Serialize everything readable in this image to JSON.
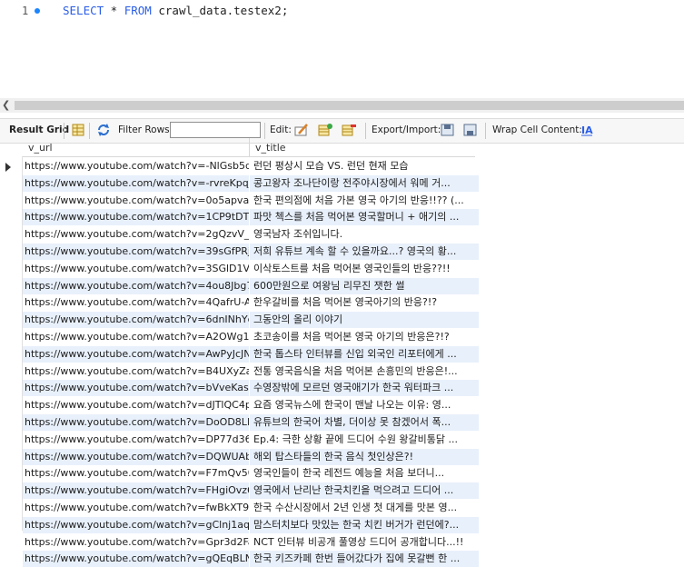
{
  "editor": {
    "line_number": "1",
    "keyword_select": "SELECT",
    "star": " * ",
    "keyword_from": "FROM",
    "table": " crawl_data.testex2;"
  },
  "toolbar": {
    "result_grid": "Result Grid",
    "filter_rows": "Filter Rows:",
    "filter_value": "",
    "edit": "Edit:",
    "export_import": "Export/Import:",
    "wrap_cell": "Wrap Cell Content:"
  },
  "grid": {
    "columns": [
      "v_url",
      "v_title"
    ],
    "rows": [
      {
        "url": "https://www.youtube.com/watch?v=-NlGsb5dmPI",
        "title": "런던 평상시 모습 VS. 런던 현재 모습"
      },
      {
        "url": "https://www.youtube.com/watch?v=-rvreKpqjeY",
        "title": "콩고왕자 조나단이랑 전주야시장에서 워메 거..."
      },
      {
        "url": "https://www.youtube.com/watch?v=0o5apvaD...",
        "title": "한국 편의점에 처음 가본 영국 아기의 반응!!?? (..."
      },
      {
        "url": "https://www.youtube.com/watch?v=1CP9tDTE...",
        "title": "파맛 첵스를 처음 먹어본 영국할머니 + 애기의 ..."
      },
      {
        "url": "https://www.youtube.com/watch?v=2gQzvV_y...",
        "title": "영국남자 조쉬입니다."
      },
      {
        "url": "https://www.youtube.com/watch?v=39sGfPRjb...",
        "title": "저희 유튜브 계속 할 수 있을까요...? 영국의 황..."
      },
      {
        "url": "https://www.youtube.com/watch?v=3SGlD1VZ...",
        "title": "이삭토스트를 처음 먹어본 영국인들의 반응??!!"
      },
      {
        "url": "https://www.youtube.com/watch?v=4ou8Jbg7...",
        "title": "600만원으로 여왕님 리무진 잿한 썰"
      },
      {
        "url": "https://www.youtube.com/watch?v=4QafrU-AX9I",
        "title": "한우갈비를 처음 먹어본 영국아기의 반응?!?"
      },
      {
        "url": "https://www.youtube.com/watch?v=6dnINhYg...",
        "title": "그동안의 올리 이야기"
      },
      {
        "url": "https://www.youtube.com/watch?v=A2OWg1h...",
        "title": "초코송이를 처음 먹어본 영국 아기의 반응은?!?"
      },
      {
        "url": "https://www.youtube.com/watch?v=AwPyJcJN...",
        "title": "한국 톱스타 인터뷰를 신입 외국인 리포터에게 ..."
      },
      {
        "url": "https://www.youtube.com/watch?v=B4UXyZaE...",
        "title": "전통 영국음식을 처음 먹어본 손흥민의 반응은!..."
      },
      {
        "url": "https://www.youtube.com/watch?v=bVveKasF...",
        "title": "수영장밖에 모르던 영국애기가 한국 워터파크 ..."
      },
      {
        "url": "https://www.youtube.com/watch?v=dJTlQC4p...",
        "title": "요즘 영국뉴스에 한국이 맨날 나오는 이유: 영..."
      },
      {
        "url": "https://www.youtube.com/watch?v=DoOD8LB...",
        "title": "유튜브의 한국어 차별, 더이상 못 참겠어서 폭..."
      },
      {
        "url": "https://www.youtube.com/watch?v=DP77d366...",
        "title": "Ep.4: 극한 상황 끝에 드디어 수원 왕갈비통닭 ..."
      },
      {
        "url": "https://www.youtube.com/watch?v=DQWUAb-...",
        "title": "해외 탑스타들의 한국 음식 첫인상은?!"
      },
      {
        "url": "https://www.youtube.com/watch?v=F7mQv50...",
        "title": "영국인들이 한국 레전드 예능을 처음 보더니..."
      },
      {
        "url": "https://www.youtube.com/watch?v=FHgiOvz6...",
        "title": "영국에서 난리난 한국치킨을 먹으려고 드디어 ..."
      },
      {
        "url": "https://www.youtube.com/watch?v=fwBkXT9P...",
        "title": "한국 수산시장에서 2년 인생 첫 대게를 맛본 영..."
      },
      {
        "url": "https://www.youtube.com/watch?v=gClnj1aqc3E",
        "title": "맘스터치보다 맛있는 한국 치킨 버거가 런던에?..."
      },
      {
        "url": "https://www.youtube.com/watch?v=Gpr3d2Fa...",
        "title": "NCT 인터뷰 비공개 풀영상 드디어 공개합니다...!!"
      },
      {
        "url": "https://www.youtube.com/watch?v=gQEqBLNt...",
        "title": "한국 키즈카페 한번 들어갔다가 집에 못갈뻔 한 ..."
      }
    ]
  }
}
